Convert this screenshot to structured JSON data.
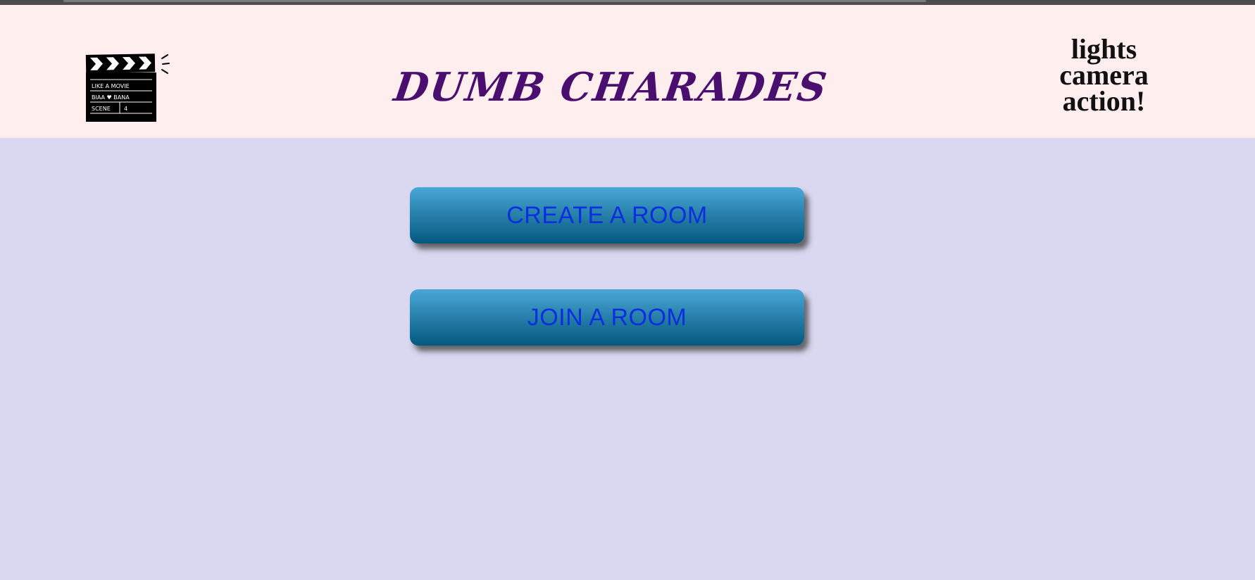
{
  "header": {
    "logo_icon": "clapperboard-icon",
    "logo_text": [
      "LIKE A MOVIE",
      "BIAA ♥ BANA",
      "SCENE",
      "4"
    ],
    "title": "DUMB CHARADES",
    "tagline": [
      "lights",
      "camera",
      "action!"
    ]
  },
  "main": {
    "create_button_label": "CREATE A ROOM",
    "join_button_label": "JOIN A ROOM"
  },
  "colors": {
    "header_bg": "#ffeeed",
    "page_bg": "#dad8f0",
    "title": "#4a0f6e",
    "button_top": "#4aa8d6",
    "button_bottom": "#03587e",
    "button_text": "#0a2fe0"
  }
}
